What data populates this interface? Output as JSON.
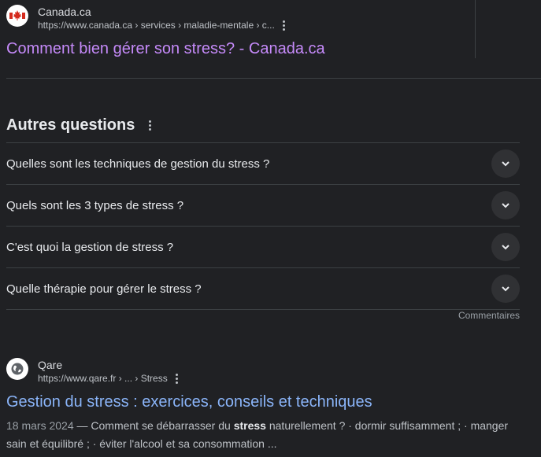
{
  "result1": {
    "site_name": "Canada.ca",
    "url": "https://www.canada.ca › services › maladie-mentale › c...",
    "title": "Comment bien gérer son stress? - Canada.ca"
  },
  "paa": {
    "title": "Autres questions",
    "questions": [
      "Quelles sont les techniques de gestion du stress ?",
      "Quels sont les 3 types de stress ?",
      "C'est quoi la gestion de stress ?",
      "Quelle thérapie pour gérer le stress ?"
    ],
    "feedback": "Commentaires"
  },
  "result2": {
    "site_name": "Qare",
    "url": "https://www.qare.fr › ... › Stress",
    "title": "Gestion du stress : exercices, conseils et techniques",
    "snippet": {
      "date": "18 mars 2024",
      "sep": " — ",
      "pre": "Comment se débarrasser du ",
      "bold": "stress",
      "post": " naturellement ? · dormir suffisamment ; · manger sain et équilibré ; · éviter l'alcool et sa consommation ..."
    }
  },
  "colors": {
    "background": "#202124",
    "visited_link": "#c58af9",
    "link": "#8ab4f8"
  }
}
